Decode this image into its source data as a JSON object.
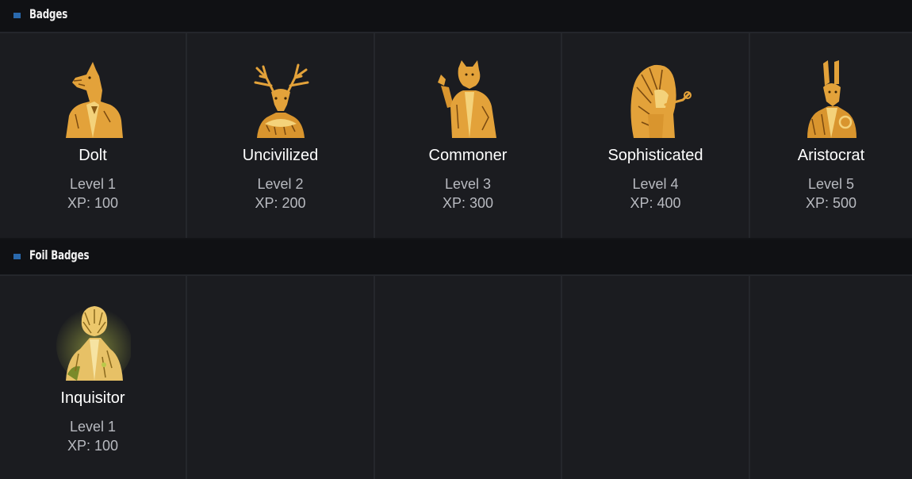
{
  "sections": [
    {
      "title": "Badges",
      "badges": [
        {
          "name": "Dolt",
          "level": "Level 1",
          "xp": "XP: 100",
          "icon": "llama-in-suit-icon"
        },
        {
          "name": "Uncivilized",
          "level": "Level 2",
          "xp": "XP: 200",
          "icon": "stag-in-ruffled-collar-icon"
        },
        {
          "name": "Commoner",
          "level": "Level 3",
          "xp": "XP: 300",
          "icon": "cat-in-suit-icon"
        },
        {
          "name": "Sophisticated",
          "level": "Level 4",
          "xp": "XP: 400",
          "icon": "lion-with-pipe-icon"
        },
        {
          "name": "Aristocrat",
          "level": "Level 5",
          "xp": "XP: 500",
          "icon": "hare-with-monocle-icon"
        }
      ]
    },
    {
      "title": "Foil Badges",
      "badges": [
        {
          "name": "Inquisitor",
          "level": "Level 1",
          "xp": "XP: 100",
          "icon": "foil-lion-in-coat-icon"
        }
      ]
    }
  ],
  "colors": {
    "accent": "#2a69ad",
    "gold": "#e8a83c",
    "foil_glow": "#b9c94a",
    "cell_bg": "#1b1c20",
    "header_bg": "#101114"
  }
}
